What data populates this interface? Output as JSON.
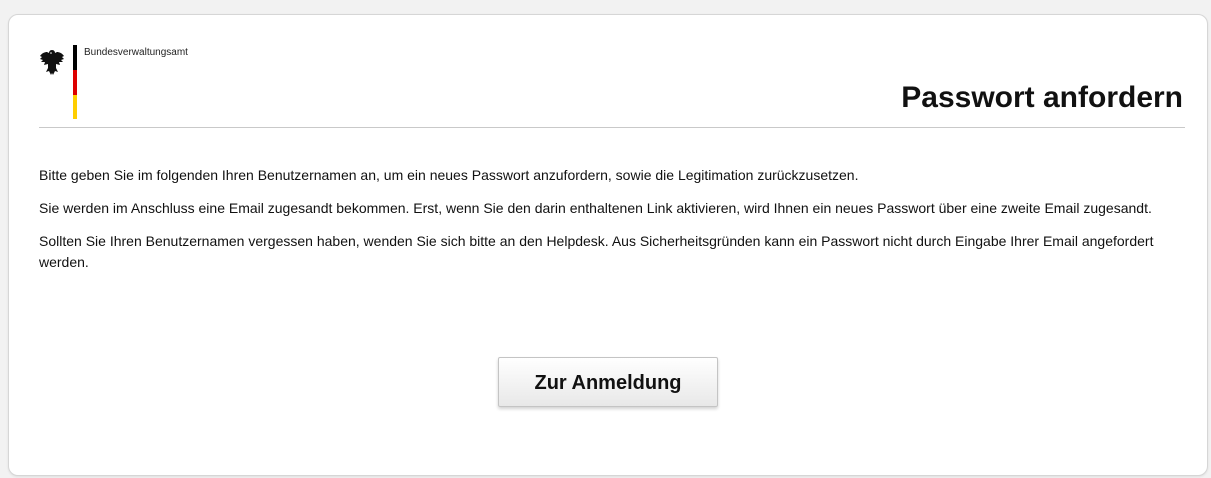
{
  "header": {
    "agency_name": "Bundesverwaltungsamt",
    "logo_icon": "federal-eagle-icon",
    "flag_colors": [
      "#000000",
      "#dd0000",
      "#ffce00"
    ]
  },
  "page": {
    "title": "Passwort anfordern"
  },
  "content": {
    "paragraphs": [
      "Bitte geben Sie im folgenden Ihren Benutzernamen an, um ein neues Passwort anzufordern, sowie die Legitimation zurückzusetzen.",
      "Sie werden im Anschluss eine Email zugesandt bekommen. Erst, wenn Sie den darin enthaltenen Link aktivieren, wird Ihnen ein neues Passwort über eine zweite Email zugesandt.",
      "Sollten Sie Ihren Benutzernamen vergessen haben, wenden Sie sich bitte an den Helpdesk. Aus Sicherheitsgründen kann ein Passwort nicht durch Eingabe Ihrer Email angefordert werden."
    ]
  },
  "actions": {
    "login_label": "Zur Anmeldung"
  }
}
